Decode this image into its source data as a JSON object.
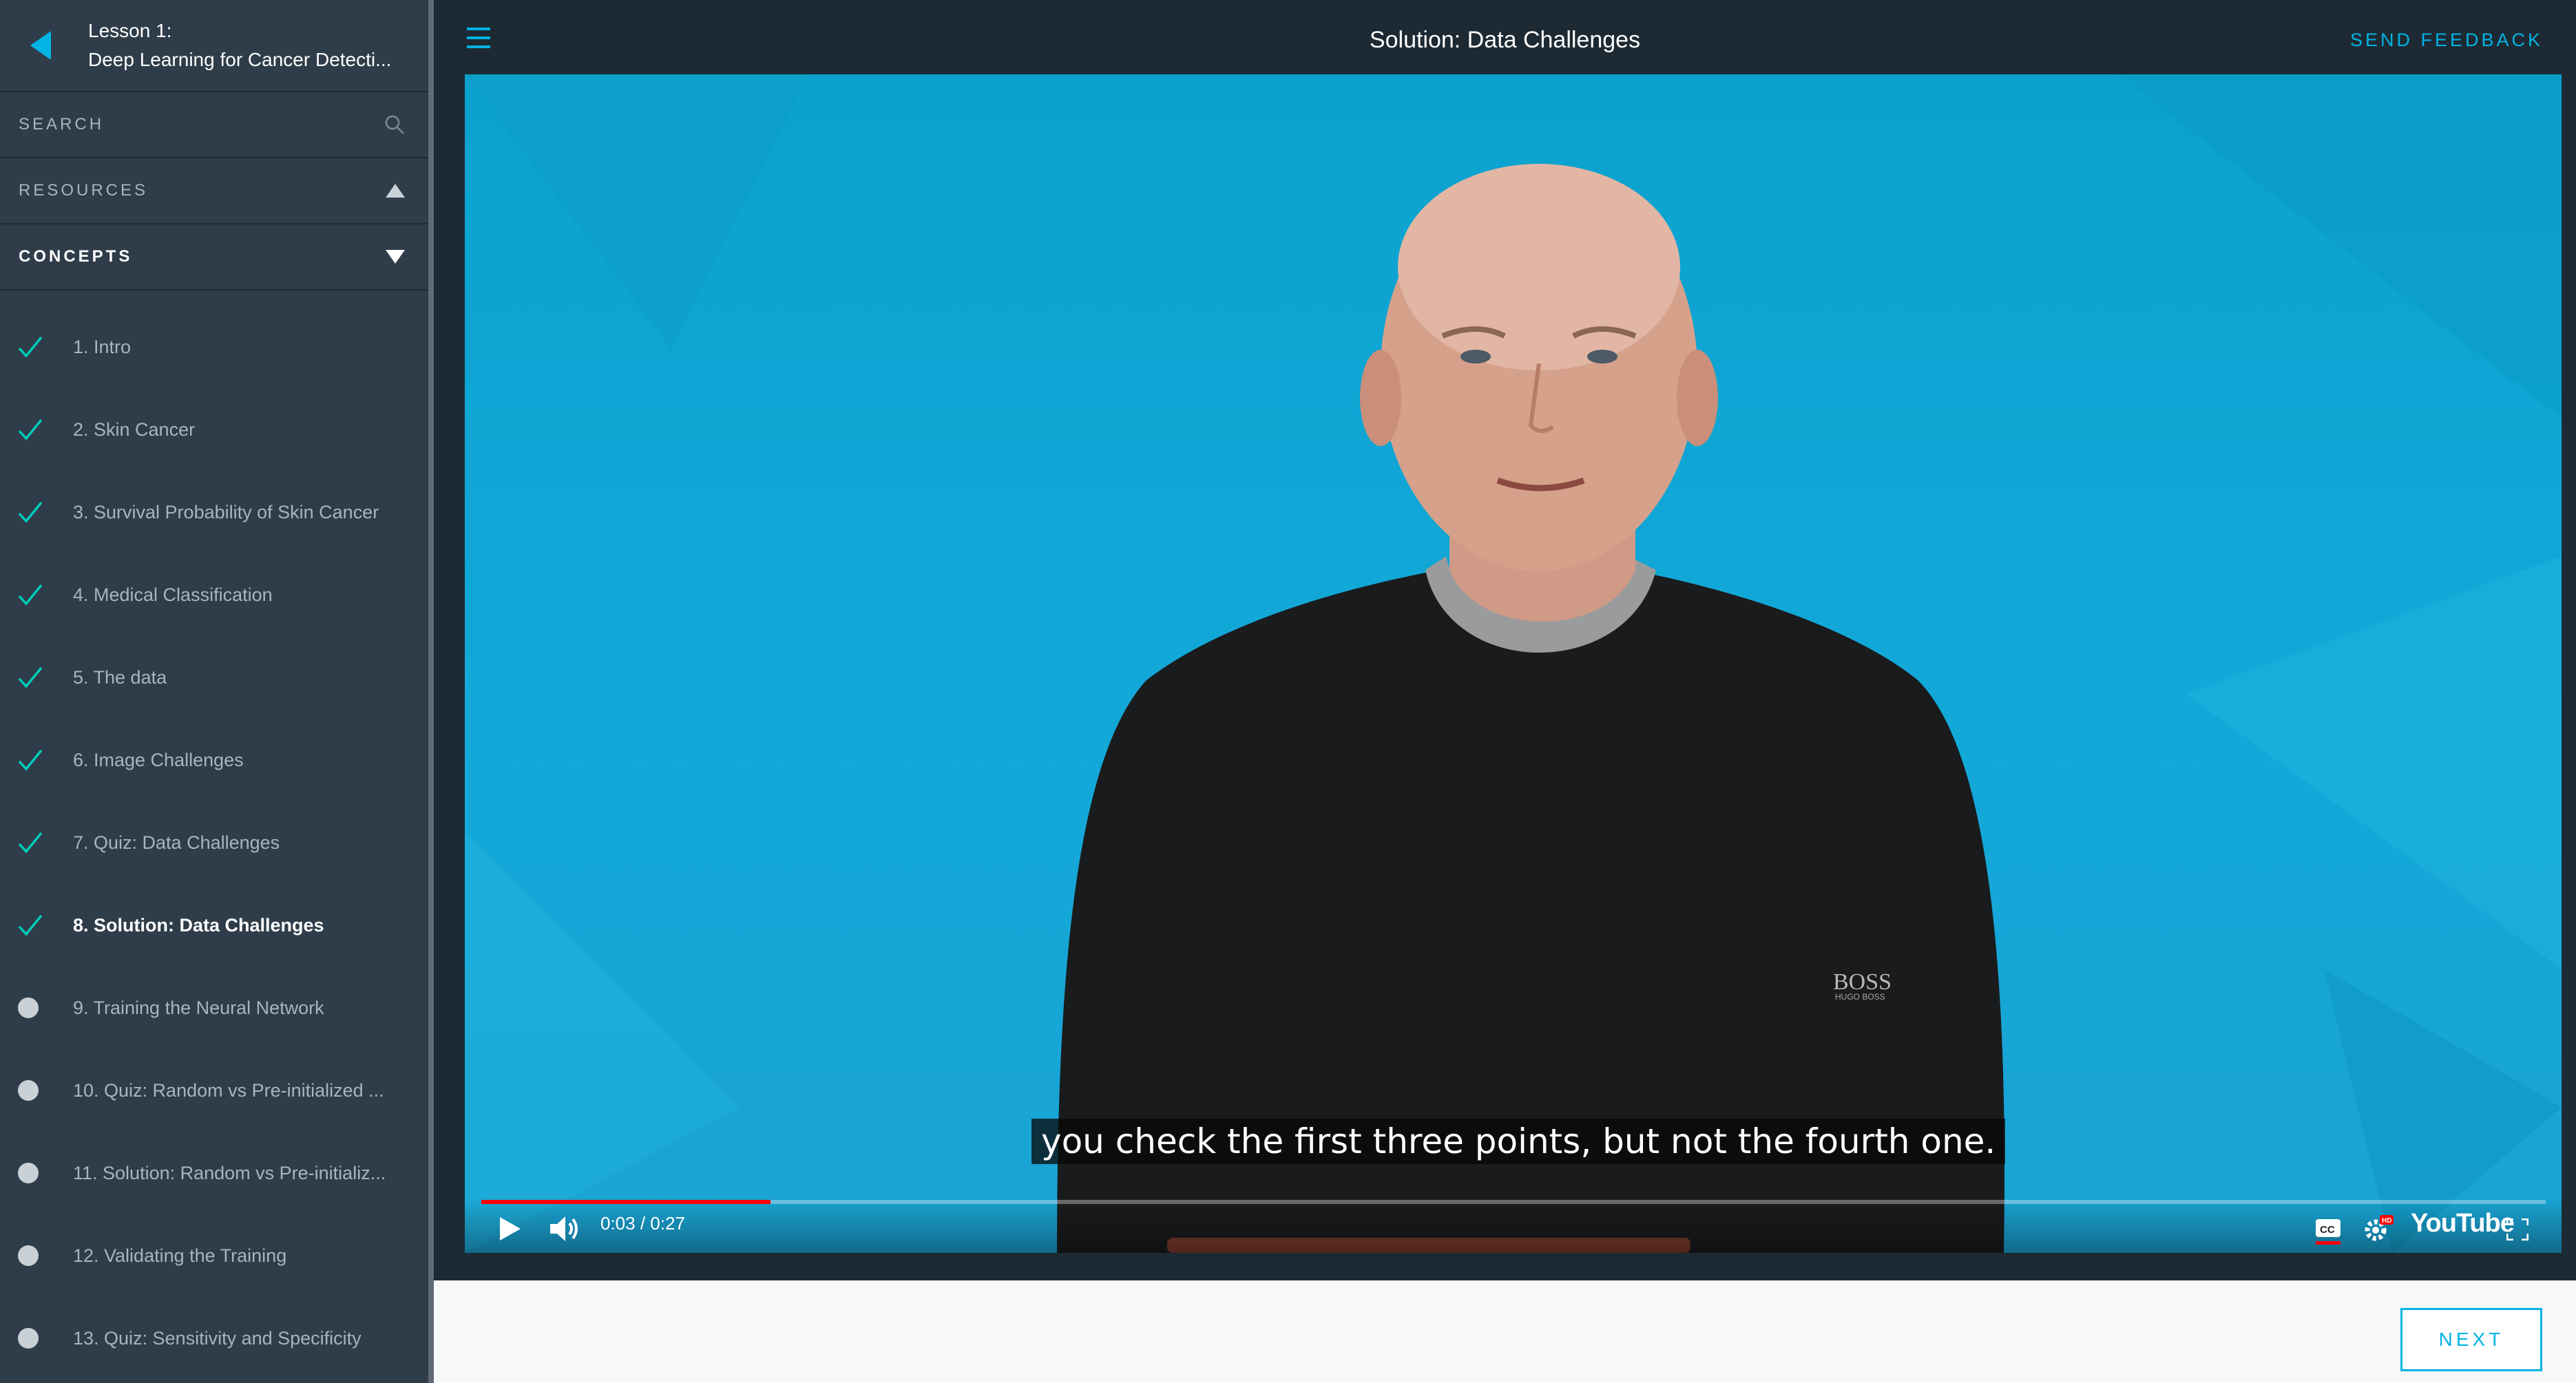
{
  "sidebar": {
    "lesson_label": "Lesson 1:",
    "lesson_title": "Deep Learning for Cancer Detecti...",
    "search_label": "SEARCH",
    "resources_label": "RESOURCES",
    "concepts_label": "CONCEPTS",
    "concepts": [
      {
        "label": "1. Intro",
        "status": "done"
      },
      {
        "label": "2. Skin Cancer",
        "status": "done"
      },
      {
        "label": "3. Survival Probability of Skin Cancer",
        "status": "done"
      },
      {
        "label": "4. Medical Classification",
        "status": "done"
      },
      {
        "label": "5. The data",
        "status": "done"
      },
      {
        "label": "6. Image Challenges",
        "status": "done"
      },
      {
        "label": "7. Quiz: Data Challenges",
        "status": "done"
      },
      {
        "label": "8. Solution: Data Challenges",
        "status": "current"
      },
      {
        "label": "9. Training the Neural Network",
        "status": "todo"
      },
      {
        "label": "10. Quiz: Random vs Pre-initialized ...",
        "status": "todo"
      },
      {
        "label": "11. Solution: Random vs Pre-initializ...",
        "status": "todo"
      },
      {
        "label": "12. Validating the Training",
        "status": "todo"
      },
      {
        "label": "13. Quiz: Sensitivity and Specificity",
        "status": "todo"
      }
    ]
  },
  "topbar": {
    "title": "Solution: Data Challenges",
    "feedback_label": "SEND FEEDBACK"
  },
  "video": {
    "caption": "you check the first three points, but not the fourth one.",
    "time": "0:03 / 0:27",
    "progress": 0.14,
    "player_brand": "YouTube",
    "shirt_logo": "BOSS",
    "shirt_logo_sub": "HUGO BOSS"
  },
  "footer": {
    "next_label": "NEXT"
  },
  "colors": {
    "accent": "#02b3e4",
    "sidebar_bg": "#2e3d49",
    "topbar_bg": "#1d2a33",
    "check": "#02ccba"
  }
}
